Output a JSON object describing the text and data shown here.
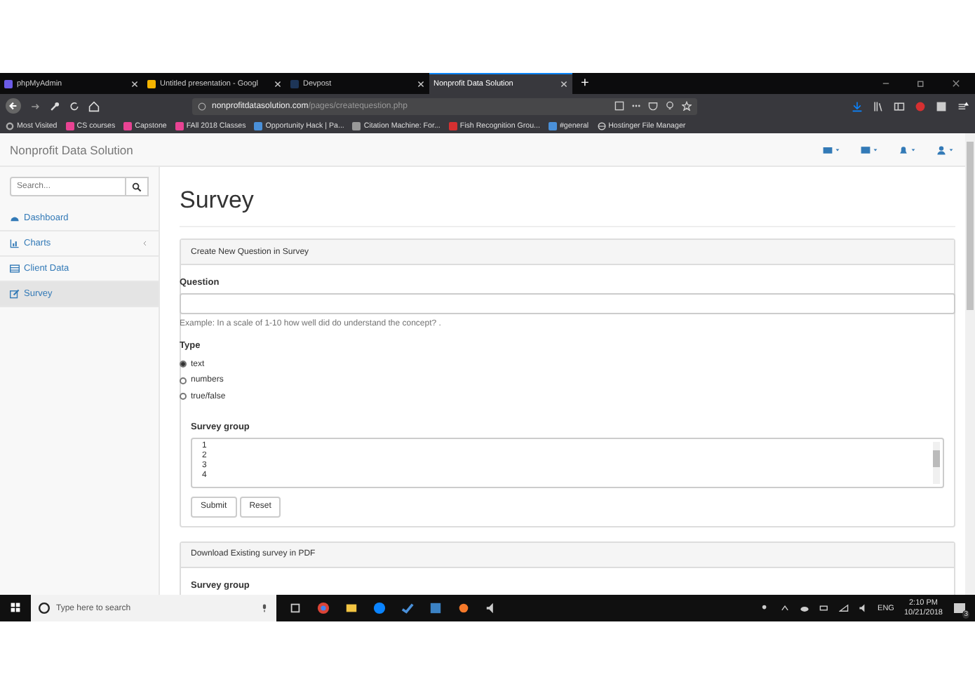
{
  "browser": {
    "tabs": [
      {
        "title": "phpMyAdmin",
        "selected": false
      },
      {
        "title": "Untitled presentation - Googl",
        "selected": false
      },
      {
        "title": "Devpost",
        "selected": false
      },
      {
        "title": "Nonprofit Data Solution",
        "selected": true
      }
    ],
    "new_tab": "+",
    "url_host": "nonprofitdatasolution.com",
    "url_path": "/pages/createquestion.php",
    "bookmarks": [
      "Most Visited",
      "CS courses",
      "Capstone",
      "FAll 2018 Classes",
      "Opportunity Hack | Pa...",
      "Citation Machine: For...",
      "Fish Recognition Grou...",
      "#general",
      "Hostinger File Manager"
    ]
  },
  "app": {
    "brand": "Nonprofit Data Solution",
    "search": {
      "placeholder": "Search..."
    },
    "sidebar": [
      {
        "label": "Dashboard",
        "caret": false,
        "selected": false
      },
      {
        "label": "Charts",
        "caret": true,
        "selected": false
      },
      {
        "label": "Client Data",
        "caret": false,
        "selected": false
      },
      {
        "label": "Survey",
        "caret": false,
        "selected": true
      }
    ],
    "title": "Survey",
    "create_panel": {
      "heading": "Create New Question in Survey",
      "question_label": "Question",
      "hint": "Example: In a scale of 1-10 how well did do understand the concept? .",
      "type_label": "Type",
      "types": [
        {
          "label": "text",
          "selected": true
        },
        {
          "label": "numbers",
          "selected": false
        },
        {
          "label": "true/false",
          "selected": false
        }
      ],
      "group_label": "Survey group",
      "group_options": [
        "1",
        "2",
        "3",
        "4"
      ],
      "buttons": [
        "Submit",
        "Reset"
      ]
    },
    "download_panel": {
      "heading": "Download Existing survey in PDF",
      "group_label": "Survey group"
    }
  },
  "taskbar": {
    "search_placeholder": "Type here to search",
    "lang": "ENG",
    "time": "2:10 PM",
    "date": "10/21/2018",
    "notification_count": "3"
  }
}
